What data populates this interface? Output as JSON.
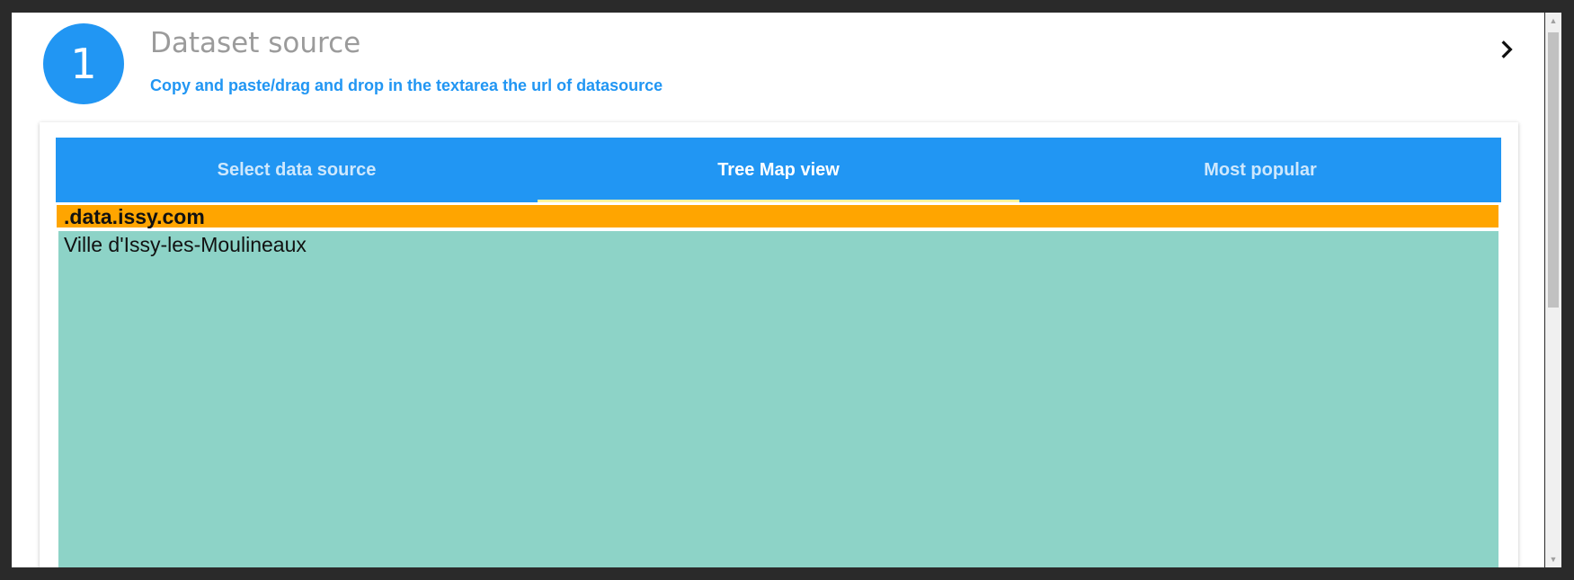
{
  "step": {
    "number": "1",
    "title": "Dataset source",
    "subtitle": "Copy and paste/drag and drop in the textarea the url of datasource",
    "expand_icon": "chevron-right-icon"
  },
  "tabs": [
    {
      "label": "Select data source",
      "active": false
    },
    {
      "label": "Tree Map view",
      "active": true
    },
    {
      "label": "Most popular",
      "active": false
    }
  ],
  "treemap": {
    "header": ".data.issy.com",
    "nodes": [
      {
        "label": "Ville d'Issy-les-Moulineaux"
      }
    ]
  },
  "colors": {
    "accent": "#2196f3",
    "tab_indicator": "#fff59d",
    "treemap_header": "#ffa500",
    "treemap_node": "#8dd3c7"
  }
}
